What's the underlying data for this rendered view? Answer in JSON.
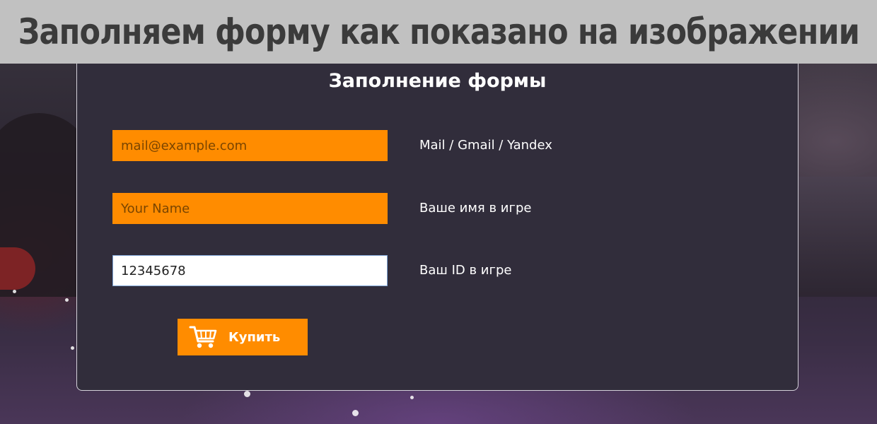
{
  "banner": {
    "heading": "Заполняем форму как показано на изображении"
  },
  "form": {
    "title": "Заполнение формы",
    "email": {
      "placeholder": "mail@example.com",
      "value": "",
      "label": "Mail / Gmail / Yandex"
    },
    "name": {
      "placeholder": "Your Name",
      "value": "",
      "label": "Ваше имя в игре"
    },
    "id": {
      "placeholder": "",
      "value": "12345678",
      "label": "Ваш ID в игре"
    },
    "buy_button": {
      "label": "Купить",
      "icon": "cart-icon"
    }
  },
  "colors": {
    "accent": "#ff8c00",
    "card": "#312d3b",
    "banner": "#c1c1c1",
    "banner_text": "#3b3b3b"
  }
}
